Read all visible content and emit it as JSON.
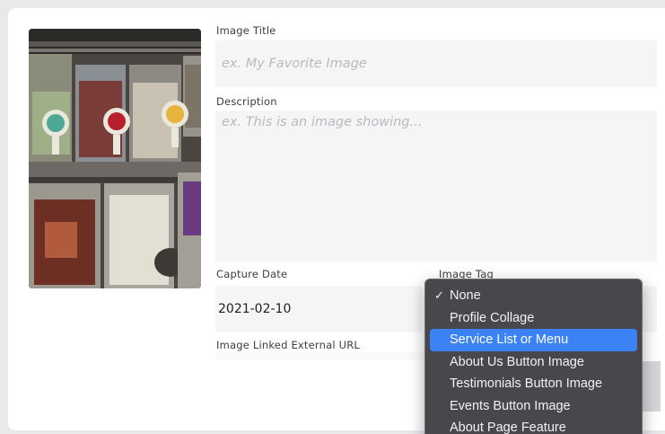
{
  "form": {
    "image_title_label": "Image Title",
    "image_title_placeholder": "ex. My Favorite Image",
    "image_title_value": "",
    "description_label": "Description",
    "description_placeholder": "ex. This is an image showing...",
    "description_value": "",
    "capture_date_label": "Capture Date",
    "capture_date_value": "2021-02-10",
    "image_tag_label": "Image Tag",
    "linked_url_label": "Image Linked External URL",
    "linked_url_value": ""
  },
  "dropdown": {
    "check_glyph": "✓",
    "checked_option": "None",
    "highlighted_option": "Service List or Menu",
    "options": [
      "None",
      "Profile Collage",
      "Service List or Menu",
      "About Us Button Image",
      "Testimonials Button Image",
      "Events Button Image",
      "About Page Feature"
    ]
  },
  "colors": {
    "highlight": "#3b82f6",
    "menu_background": "#424246",
    "placeholder": "#b9b9bf"
  },
  "icons": {
    "check": "checkmark-icon"
  }
}
